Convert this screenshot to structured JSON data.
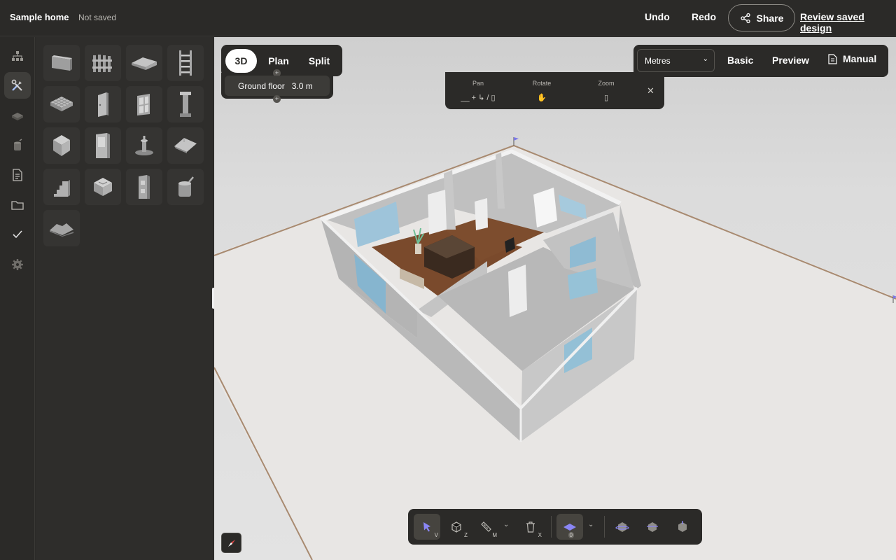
{
  "header": {
    "project_name": "Sample home",
    "save_status": "Not saved",
    "undo_label": "Undo",
    "redo_label": "Redo",
    "share_label": "Share",
    "review_label": "Review saved design"
  },
  "sidebar_icons": [
    "hierarchy-icon",
    "tools-icon",
    "materials-icon",
    "paint-bucket-icon",
    "document-icon",
    "folder-icon",
    "checkmark-icon",
    "settings-gear-icon"
  ],
  "palette_items": [
    "wall",
    "fence",
    "slab",
    "ladder",
    "grid-floor",
    "door",
    "window",
    "column",
    "cube-object",
    "cabinet",
    "fountain",
    "roof",
    "stairs",
    "room-module",
    "appliance",
    "paint-can",
    "terrain"
  ],
  "view_switch": {
    "tabs": [
      {
        "label": "3D",
        "active": true
      },
      {
        "label": "Plan",
        "active": false
      },
      {
        "label": "Split",
        "active": false
      }
    ],
    "floor_name": "Ground floor",
    "floor_height": "3.0 m"
  },
  "navigation_help": {
    "pan_label": "Pan",
    "pan_keys": "__ + ↳ / ▯",
    "rotate_label": "Rotate",
    "rotate_keys": "✋",
    "zoom_label": "Zoom",
    "zoom_keys": "▯"
  },
  "right_panel": {
    "units_value": "Metres",
    "basic_label": "Basic",
    "preview_label": "Preview",
    "manual_label": "Manual"
  },
  "toolbar": {
    "tools": [
      {
        "name": "select-tool",
        "key": "V",
        "active": true
      },
      {
        "name": "component-tool",
        "key": "Z",
        "active": false
      },
      {
        "name": "measure-tool",
        "key": "M",
        "active": false
      },
      {
        "name": "delete-tool",
        "key": "X",
        "active": false
      },
      {
        "name": "floor-layer-tool",
        "key": "0",
        "active": true
      },
      {
        "name": "view-top-tool",
        "key": "",
        "active": false
      },
      {
        "name": "view-iso-tool",
        "key": "",
        "active": false
      },
      {
        "name": "view-side-tool",
        "key": "",
        "active": false
      }
    ]
  },
  "colors": {
    "chrome": "#2b2a28",
    "accent": "#8a86f5",
    "floor_wood": "#7a4a2c",
    "rug_pink": "#e8a0a8",
    "wall_grey": "#b8b8b8"
  }
}
